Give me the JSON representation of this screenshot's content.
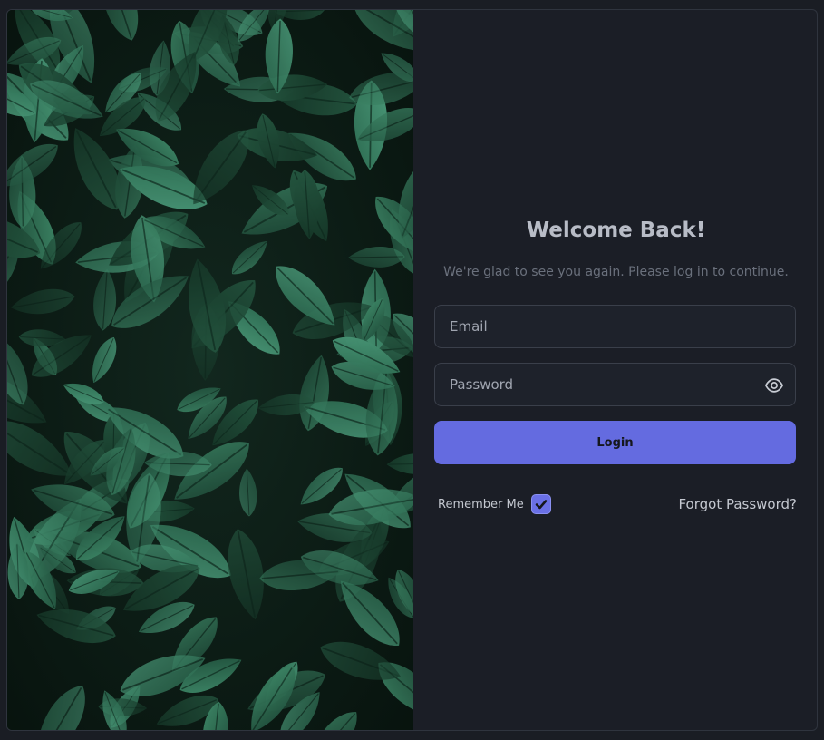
{
  "image": {
    "description_icon": "leaves-photo"
  },
  "form": {
    "title": "Welcome Back!",
    "subtitle": "We're glad to see you again. Please log in to continue.",
    "email_placeholder": "Email",
    "email_value": "",
    "password_placeholder": "Password",
    "password_value": "",
    "password_toggle_icon": "eye-icon",
    "login_label": "Login",
    "remember_label": "Remember Me",
    "remember_checked": true,
    "forgot_label": "Forgot Password?"
  },
  "colors": {
    "background": "#1a1d24",
    "card": "#1b1e26",
    "accent": "#646be0",
    "title": "#b8bcc6",
    "subtitle": "#6a707c"
  }
}
